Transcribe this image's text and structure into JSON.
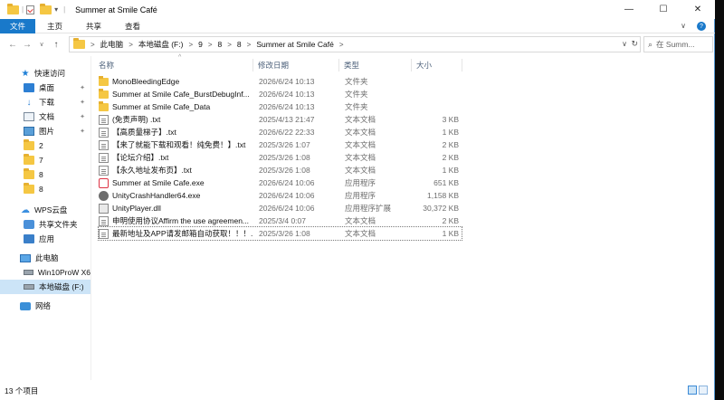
{
  "window": {
    "title": "Summer at Smile Café",
    "controls": {
      "minimize": "—",
      "maximize": "☐",
      "close": "✕"
    }
  },
  "ribbon": {
    "tabs": [
      "文件",
      "主页",
      "共享",
      "查看"
    ],
    "expand_glyph": "∨",
    "help_glyph": "?"
  },
  "nav": {
    "back": "←",
    "forward": "→",
    "recent": "∨",
    "up": "↑"
  },
  "address": {
    "crumbs": [
      "此电脑",
      "本地磁盘 (F:)",
      "9",
      "8",
      "8",
      "Summer at Smile Café"
    ],
    "separator": ">",
    "dropdown_glyph": "∨",
    "refresh_glyph": "↻"
  },
  "search": {
    "placeholder": "在 Summ...",
    "icon": "search-icon",
    "glyph": "⌕"
  },
  "sidebar": {
    "quick_access": "快速访问",
    "items": [
      {
        "label": "桌面",
        "icon": "desktop-icon",
        "pinned": true
      },
      {
        "label": "下载",
        "icon": "download-icon",
        "pinned": true
      },
      {
        "label": "文档",
        "icon": "documents-icon",
        "pinned": true
      },
      {
        "label": "图片",
        "icon": "pictures-icon",
        "pinned": true
      },
      {
        "label": "2",
        "icon": "folder-icon",
        "pinned": false
      },
      {
        "label": "7",
        "icon": "folder-icon",
        "pinned": false
      },
      {
        "label": "8",
        "icon": "folder-icon",
        "pinned": false
      },
      {
        "label": "8",
        "icon": "folder-icon",
        "pinned": false
      }
    ],
    "wps": "WPS云盘",
    "wps_items": [
      {
        "label": "共享文件夹",
        "icon": "shared-folder-icon"
      },
      {
        "label": "应用",
        "icon": "apps-icon"
      }
    ],
    "this_pc": "此电脑",
    "drives": [
      {
        "label": "Win10ProW X6",
        "icon": "drive-icon"
      },
      {
        "label": "本地磁盘 (F:)",
        "icon": "drive-icon",
        "selected": true
      }
    ],
    "network": "网络",
    "pin_glyph": "✦"
  },
  "columns": {
    "name": "名称",
    "date": "修改日期",
    "type": "类型",
    "size": "大小",
    "sort_glyph": "^"
  },
  "files": [
    {
      "name": "MonoBleedingEdge",
      "date": "2026/6/24 10:13",
      "type": "文件夹",
      "size": "",
      "icon": "folder"
    },
    {
      "name": "Summer at Smile Cafe_BurstDebugInf...",
      "date": "2026/6/24 10:13",
      "type": "文件夹",
      "size": "",
      "icon": "folder"
    },
    {
      "name": "Summer at Smile Cafe_Data",
      "date": "2026/6/24 10:13",
      "type": "文件夹",
      "size": "",
      "icon": "folder"
    },
    {
      "name": "(免责声明) .txt",
      "date": "2025/4/13 21:47",
      "type": "文本文档",
      "size": "3 KB",
      "icon": "txt"
    },
    {
      "name": "【高质量梯子】.txt",
      "date": "2026/6/22 22:33",
      "type": "文本文档",
      "size": "1 KB",
      "icon": "txt"
    },
    {
      "name": "【来了就能下载和观看！纯免费！】.txt",
      "date": "2025/3/26 1:07",
      "type": "文本文档",
      "size": "2 KB",
      "icon": "txt"
    },
    {
      "name": "【论坛介绍】.txt",
      "date": "2025/3/26 1:08",
      "type": "文本文档",
      "size": "2 KB",
      "icon": "txt"
    },
    {
      "name": "【永久地址发布页】.txt",
      "date": "2025/3/26 1:08",
      "type": "文本文档",
      "size": "1 KB",
      "icon": "txt"
    },
    {
      "name": "Summer at Smile Cafe.exe",
      "date": "2026/6/24 10:06",
      "type": "应用程序",
      "size": "651 KB",
      "icon": "exe-red"
    },
    {
      "name": "UnityCrashHandler64.exe",
      "date": "2026/6/24 10:06",
      "type": "应用程序",
      "size": "1,158 KB",
      "icon": "exe-gray"
    },
    {
      "name": "UnityPlayer.dll",
      "date": "2026/6/24 10:06",
      "type": "应用程序扩展",
      "size": "30,372 KB",
      "icon": "dll"
    },
    {
      "name": "申明使用协议Affirm the use agreemen...",
      "date": "2025/3/4 0:07",
      "type": "文本文档",
      "size": "2 KB",
      "icon": "txt"
    },
    {
      "name": "最新地址及APP请发邮箱自动获取！！！...",
      "date": "2025/3/26 1:08",
      "type": "文本文档",
      "size": "1 KB",
      "icon": "txt"
    }
  ],
  "status": {
    "count": "13 个项目"
  }
}
